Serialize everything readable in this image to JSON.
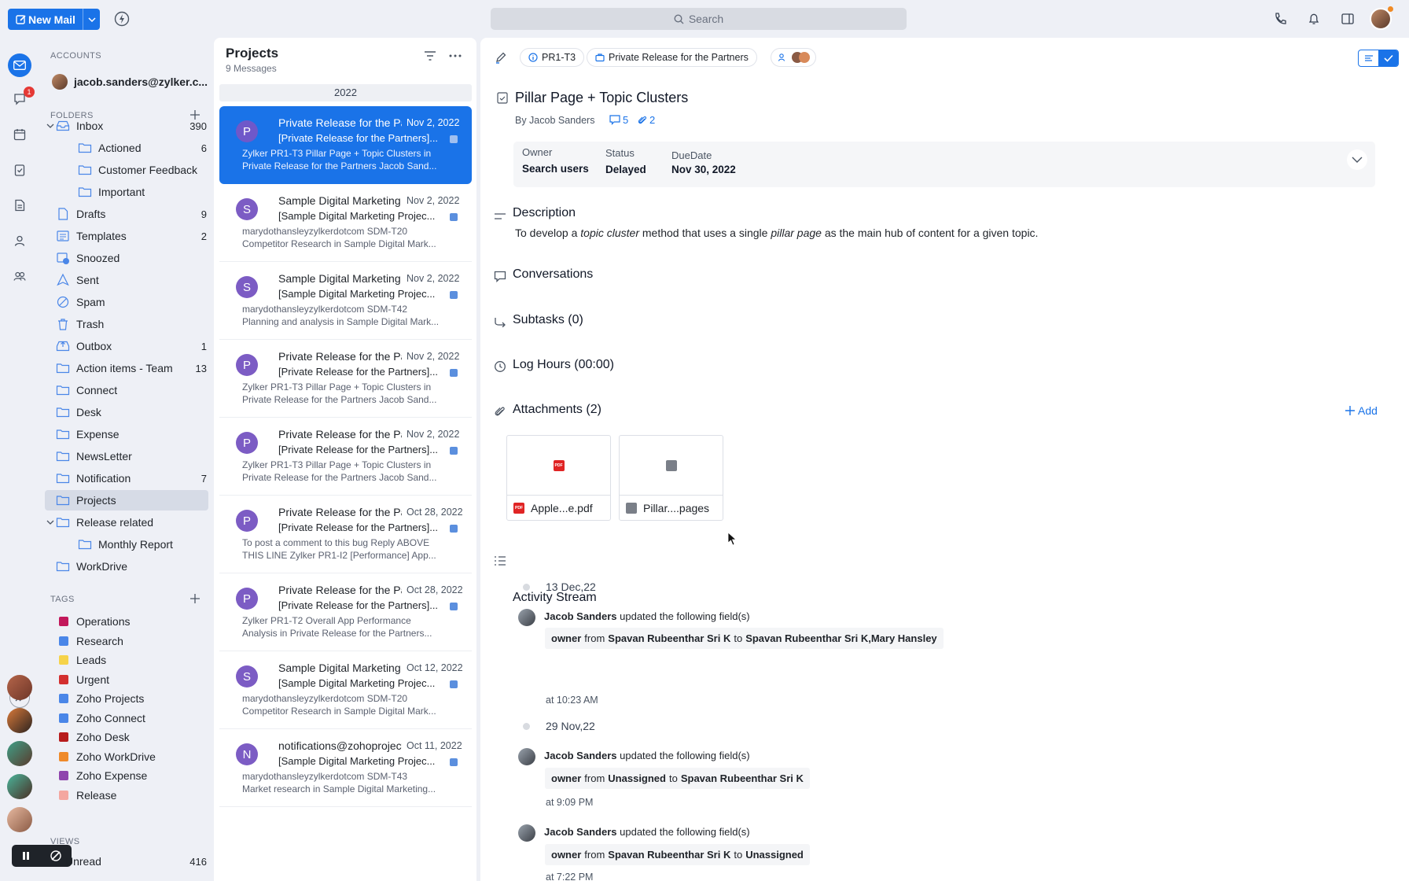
{
  "topbar": {
    "new_mail_label": "New Mail",
    "search_placeholder": "Search"
  },
  "rail": {
    "chat_badge": "1"
  },
  "accounts": {
    "heading": "ACCOUNTS",
    "email": "jacob.sanders@zylker.c..."
  },
  "folders": {
    "heading": "FOLDERS",
    "items": [
      {
        "label": "Inbox",
        "count": "390"
      },
      {
        "label": "Actioned",
        "count": "6"
      },
      {
        "label": "Customer Feedback",
        "count": ""
      },
      {
        "label": "Important",
        "count": ""
      },
      {
        "label": "Drafts",
        "count": "9"
      },
      {
        "label": "Templates",
        "count": "2"
      },
      {
        "label": "Snoozed",
        "count": ""
      },
      {
        "label": "Sent",
        "count": ""
      },
      {
        "label": "Spam",
        "count": ""
      },
      {
        "label": "Trash",
        "count": ""
      },
      {
        "label": "Outbox",
        "count": "1"
      },
      {
        "label": "Action items - Team",
        "count": "13"
      },
      {
        "label": "Connect",
        "count": ""
      },
      {
        "label": "Desk",
        "count": ""
      },
      {
        "label": "Expense",
        "count": ""
      },
      {
        "label": "NewsLetter",
        "count": ""
      },
      {
        "label": "Notification",
        "count": "7"
      },
      {
        "label": "Projects",
        "count": ""
      },
      {
        "label": "Release related",
        "count": ""
      },
      {
        "label": "Monthly Report",
        "count": ""
      },
      {
        "label": "WorkDrive",
        "count": ""
      }
    ]
  },
  "tags": {
    "heading": "TAGS",
    "items": [
      {
        "label": "Operations",
        "color": "#c2185b"
      },
      {
        "label": "Research",
        "color": "#4a86e8"
      },
      {
        "label": "Leads",
        "color": "#f6d34a"
      },
      {
        "label": "Urgent",
        "color": "#d32f2f"
      },
      {
        "label": "Zoho Projects",
        "color": "#4a86e8"
      },
      {
        "label": "Zoho Connect",
        "color": "#4a86e8"
      },
      {
        "label": "Zoho Desk",
        "color": "#b71c1c"
      },
      {
        "label": "Zoho WorkDrive",
        "color": "#ef8a2a"
      },
      {
        "label": "Zoho Expense",
        "color": "#8e44ad"
      },
      {
        "label": "Release",
        "color": "#f4a7a0"
      }
    ]
  },
  "views": {
    "heading": "VIEWS",
    "unread_label": "Unread",
    "unread_count": "416"
  },
  "message_list": {
    "title": "Projects",
    "subtitle": "9 Messages",
    "year": "2022",
    "messages": [
      {
        "initial": "P",
        "sender": "Private Release for the Partners",
        "date": "Nov 2, 2022",
        "subject": "[Private Release for the Partners]...",
        "preview1": "Zylker PR1-T3 Pillar Page + Topic Clusters in",
        "preview2": "Private Release for the Partners Jacob Sand..."
      },
      {
        "initial": "S",
        "sender": "Sample Digital Marketing",
        "date": "Nov 2, 2022",
        "subject": "[Sample Digital Marketing Projec...",
        "preview1": "marydothansleyzylkerdotcom SDM-T20",
        "preview2": "Competitor Research in Sample Digital Mark..."
      },
      {
        "initial": "S",
        "sender": "Sample Digital Marketing",
        "date": "Nov 2, 2022",
        "subject": "[Sample Digital Marketing Projec...",
        "preview1": "marydothansleyzylkerdotcom SDM-T42",
        "preview2": "Planning and analysis in Sample Digital Mark..."
      },
      {
        "initial": "P",
        "sender": "Private Release for the Partners",
        "date": "Nov 2, 2022",
        "subject": "[Private Release for the Partners]...",
        "preview1": "Zylker PR1-T3 Pillar Page + Topic Clusters in",
        "preview2": "Private Release for the Partners Jacob Sand..."
      },
      {
        "initial": "P",
        "sender": "Private Release for the Partners",
        "date": "Nov 2, 2022",
        "subject": "[Private Release for the Partners]...",
        "preview1": "Zylker PR1-T3 Pillar Page + Topic Clusters in",
        "preview2": "Private Release for the Partners Jacob Sand..."
      },
      {
        "initial": "P",
        "sender": "Private Release for the Partners",
        "date": "Oct 28, 2022",
        "subject": "[Private Release for the Partners]...",
        "preview1": "To post a comment to this bug Reply ABOVE",
        "preview2": "THIS LINE  Zylker PR1-I2 [Performance] App..."
      },
      {
        "initial": "P",
        "sender": "Private Release for the Partners",
        "date": "Oct 28, 2022",
        "subject": "[Private Release for the Partners]...",
        "preview1": "Zylker PR1-T2 Overall App Performance",
        "preview2": "Analysis in Private Release for the Partners..."
      },
      {
        "initial": "S",
        "sender": "Sample Digital Marketing",
        "date": "Oct 12, 2022",
        "subject": "[Sample Digital Marketing Projec...",
        "preview1": "marydothansleyzylkerdotcom SDM-T20",
        "preview2": "Competitor Research in Sample Digital Mark..."
      },
      {
        "initial": "N",
        "sender": "notifications@zohoprojects.com",
        "date": "Oct 11, 2022",
        "subject": "[Sample Digital Marketing Projec...",
        "preview1": "marydothansleyzylkerdotcom SDM-T43",
        "preview2": "Market research in Sample Digital Marketing..."
      }
    ]
  },
  "detail": {
    "task_id": "PR1-T3",
    "project": "Private Release for the Partners",
    "title": "Pillar Page + Topic Clusters",
    "by": "By Jacob Sanders",
    "comments_count": "5",
    "attachments_count": "2",
    "meta": {
      "owner_label": "Owner",
      "owner_value": "Search users",
      "status_label": "Status",
      "status_value": "Delayed",
      "due_label": "DueDate",
      "due_value": "Nov 30, 2022"
    },
    "description_title": "Description",
    "description": {
      "part1": "To develop a ",
      "em1": "topic cluster",
      "part2": " method that uses a single ",
      "em2": "pillar page",
      "part3": " as the main hub of content for a given topic."
    },
    "conversations_title": "Conversations",
    "subtasks_title": "Subtasks (0)",
    "loghours_title": "Log Hours (00:00)",
    "attachments_title": "Attachments (2)",
    "add_label": "Add",
    "attachments": [
      {
        "name": "Apple...e.pdf",
        "type": "pdf",
        "thumb_label": "PDF"
      },
      {
        "name": "Pillar....pages",
        "type": "pages",
        "thumb_label": ""
      }
    ],
    "activity_title": "Activity Stream",
    "activity": {
      "date1": "13 Dec,22",
      "e1_user": "Jacob Sanders",
      "e1_action": "updated the following field(s)",
      "e1_field": "owner",
      "e1_from_word": "from",
      "e1_from": "Spavan Rubeenthar Sri K",
      "e1_to_word": "to",
      "e1_to": "Spavan Rubeenthar Sri K,Mary Hansley",
      "e1_time": "at 10:23 AM",
      "date2": "29 Nov,22",
      "e2_user": "Jacob Sanders",
      "e2_action": "updated the following field(s)",
      "e2_field": "owner",
      "e2_from_word": "from",
      "e2_from": "Unassigned",
      "e2_to_word": "to",
      "e2_to": "Spavan Rubeenthar Sri K",
      "e2_time": "at 9:09 PM",
      "e3_user": "Jacob Sanders",
      "e3_action": "updated the following field(s)",
      "e3_field": "owner",
      "e3_from_word": "from",
      "e3_from": "Spavan Rubeenthar Sri K",
      "e3_to_word": "to",
      "e3_to": "Unassigned",
      "e3_time": "at 7:22 PM"
    }
  },
  "colors": {
    "accent": "#1a73e8",
    "background": "#eef0f6",
    "active_folder": "#d6dbe6"
  }
}
